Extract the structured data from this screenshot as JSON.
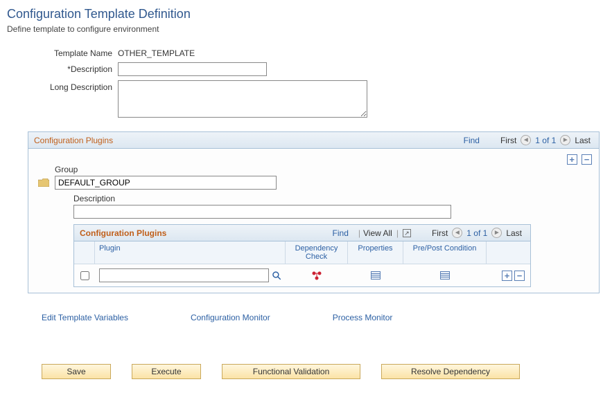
{
  "page": {
    "title": "Configuration Template Definition",
    "subtitle": "Define template to configure environment"
  },
  "form": {
    "template_name_label": "Template Name",
    "template_name_value": "OTHER_TEMPLATE",
    "description_label": "*Description",
    "description_value": "",
    "long_description_label": "Long Description",
    "long_description_value": ""
  },
  "outer_panel": {
    "title": "Configuration Plugins",
    "find": "Find",
    "first": "First",
    "counter": "1 of 1",
    "last": "Last"
  },
  "group": {
    "label": "Group",
    "value": "DEFAULT_GROUP",
    "description_label": "Description",
    "description_value": ""
  },
  "inner_panel": {
    "title": "Configuration Plugins",
    "find": "Find",
    "view_all": "View All",
    "first": "First",
    "counter": "1 of 1",
    "last": "Last",
    "cols": {
      "plugin": "Plugin",
      "dependency": "Dependency Check",
      "properties": "Properties",
      "prepost": "Pre/Post Condition"
    },
    "row": {
      "plugin_value": ""
    }
  },
  "links": {
    "edit_vars": "Edit Template Variables",
    "config_monitor": "Configuration Monitor",
    "process_monitor": "Process Monitor"
  },
  "buttons": {
    "save": "Save",
    "execute": "Execute",
    "functional_validation": "Functional Validation",
    "resolve_dependency": "Resolve Dependency"
  }
}
